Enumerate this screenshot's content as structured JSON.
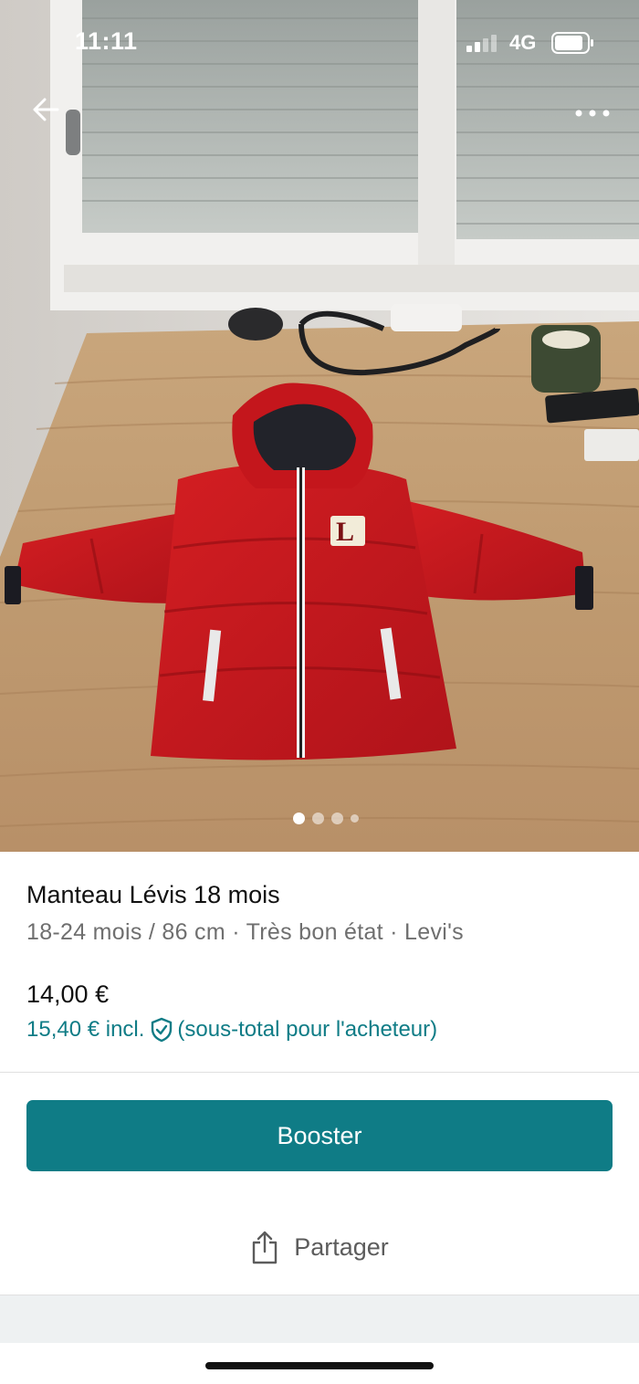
{
  "status_bar": {
    "time": "11:11",
    "network": "4G",
    "icons": [
      "signal-icon",
      "battery-icon"
    ]
  },
  "header": {
    "back_icon": "arrow-left-icon",
    "more_icon": "more-horizontal-icon"
  },
  "gallery": {
    "photo_count": 4,
    "active_index": 0
  },
  "item": {
    "title": "Manteau Lévis 18 mois",
    "details": "18-24 mois / 86 cm · Très bon état · Levi's",
    "price": "14,00 €",
    "buyer_price": "15,40 € incl.",
    "buyer_price_note": "(sous-total pour l'acheteur)",
    "protection_icon": "shield-check-icon"
  },
  "actions": {
    "booster_label": "Booster",
    "share_label": "Partager",
    "share_icon": "share-icon"
  },
  "colors": {
    "accent": "#0f7c86",
    "jacket_red": "#c4161c"
  }
}
